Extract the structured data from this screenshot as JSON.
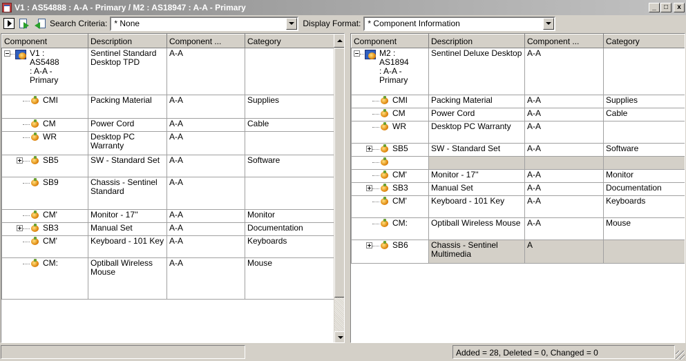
{
  "window": {
    "title": "V1 : AS54888 : A-A - Primary / M2 : AS18947 : A-A - Primary",
    "min_label": "_",
    "max_label": "□",
    "close_label": "x"
  },
  "toolbar": {
    "search_label": "Search Criteria:",
    "search_value": "* None",
    "display_label": "Display Format:",
    "display_value": "* Component Information"
  },
  "columns": [
    "Component",
    "Description",
    "Component ...",
    "Category"
  ],
  "left_rows": [
    {
      "comp": "V1 : AS5488 : A-A - Primary",
      "desc": "Sentinel Standard Desktop TPD",
      "rev": "A-A",
      "cat": ""
    },
    {
      "comp": "CMI",
      "desc": "Packing Material",
      "rev": "A-A",
      "cat": "Supplies"
    },
    {
      "comp": "CM",
      "desc": "Power Cord",
      "rev": "A-A",
      "cat": "Cable"
    },
    {
      "comp": "WR",
      "desc": "Desktop PC Warranty",
      "rev": "A-A",
      "cat": ""
    },
    {
      "comp": "SB5",
      "desc": "SW - Standard Set",
      "rev": "A-A",
      "cat": "Software"
    },
    {
      "comp": "SB9",
      "desc": "Chassis - Sentinel Standard",
      "rev": "A-A",
      "cat": ""
    },
    {
      "comp": "CM'",
      "desc": "Monitor - 17''",
      "rev": "A-A",
      "cat": "Monitor"
    },
    {
      "comp": "SB3",
      "desc": "Manual Set",
      "rev": "A-A",
      "cat": "Documentation"
    },
    {
      "comp": "CM'",
      "desc": "Keyboard - 101 Key",
      "rev": "A-A",
      "cat": "Keyboards"
    },
    {
      "comp": "CM:",
      "desc": "Optiball Wireless Mouse",
      "rev": "A-A",
      "cat": "Mouse"
    }
  ],
  "right_rows": [
    {
      "comp": "M2 : AS1894 : A-A - Primary",
      "desc": "Sentinel Deluxe Desktop",
      "rev": "A-A",
      "cat": ""
    },
    {
      "comp": "CMI",
      "desc": "Packing Material",
      "rev": "A-A",
      "cat": "Supplies"
    },
    {
      "comp": "CM",
      "desc": "Power Cord",
      "rev": "A-A",
      "cat": "Cable"
    },
    {
      "comp": "WR",
      "desc": "Desktop PC Warranty",
      "rev": "A-A",
      "cat": ""
    },
    {
      "comp": "SB5",
      "desc": "SW - Standard Set",
      "rev": "A-A",
      "cat": "Software"
    },
    {
      "comp": "",
      "desc": "",
      "rev": "",
      "cat": ""
    },
    {
      "comp": "CM'",
      "desc": "Monitor - 17''",
      "rev": "A-A",
      "cat": "Monitor"
    },
    {
      "comp": "SB3",
      "desc": "Manual Set",
      "rev": "A-A",
      "cat": "Documentation"
    },
    {
      "comp": "CM'",
      "desc": "Keyboard - 101 Key",
      "rev": "A-A",
      "cat": "Keyboards"
    },
    {
      "comp": "CM:",
      "desc": "Optiball Wireless Mouse",
      "rev": "A-A",
      "cat": "Mouse"
    },
    {
      "comp": "SB6",
      "desc": "Chassis - Sentinel Multimedia",
      "rev": "A",
      "cat": ""
    }
  ],
  "status": {
    "summary": "Added = 28, Deleted = 0, Changed = 0"
  },
  "colors": {
    "face": "#d4d0c8",
    "highlight_row": "#d4d0c8"
  }
}
